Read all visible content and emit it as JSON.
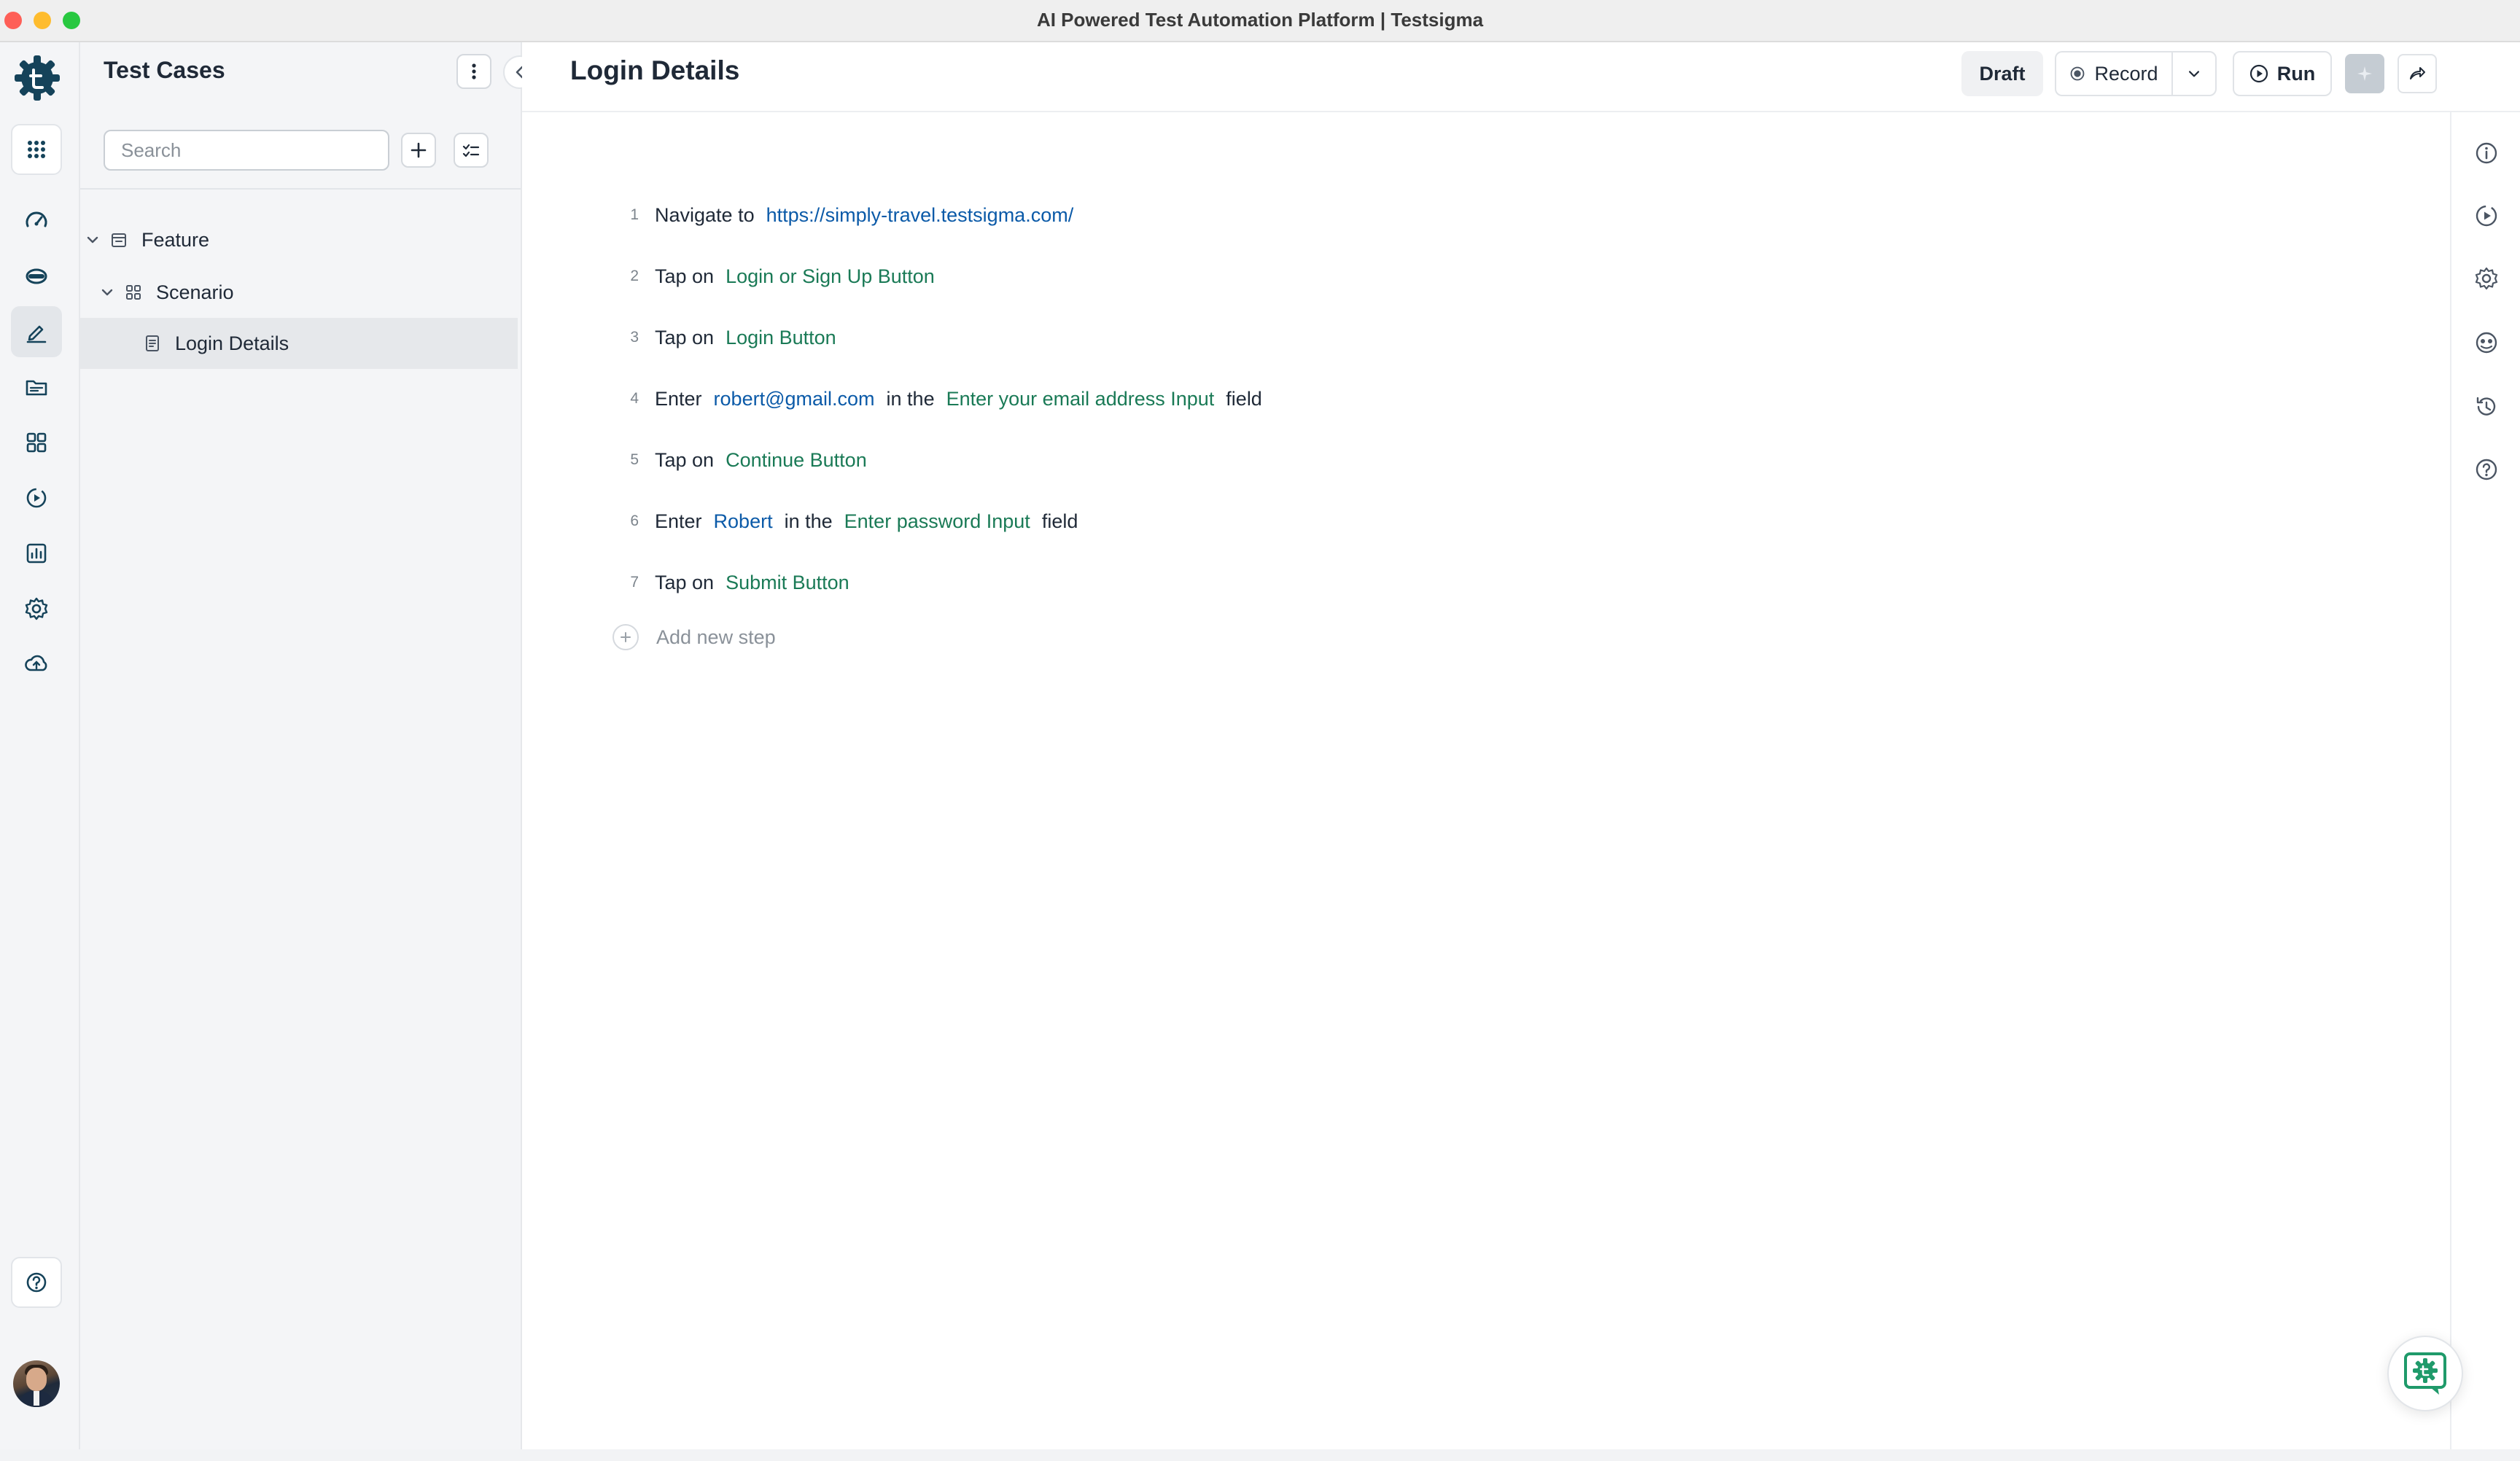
{
  "window": {
    "title": "AI Powered Test Automation Platform | Testsigma"
  },
  "sidebar": {
    "title": "Test Cases",
    "search_placeholder": "Search",
    "tree": [
      {
        "label": "Feature",
        "level": 0,
        "type": "folder"
      },
      {
        "label": "Scenario",
        "level": 1,
        "type": "group"
      },
      {
        "label": "Login Details",
        "level": 2,
        "type": "test-case",
        "selected": true
      }
    ]
  },
  "main": {
    "title": "Login Details",
    "toolbar": {
      "draft_label": "Draft",
      "record_label": "Record",
      "run_label": "Run"
    },
    "steps": [
      {
        "number": "1",
        "parts": [
          {
            "text": "Navigate to",
            "kind": "plain"
          },
          {
            "text": "https://simply-travel.testsigma.com/",
            "kind": "data"
          }
        ]
      },
      {
        "number": "2",
        "parts": [
          {
            "text": "Tap on",
            "kind": "plain"
          },
          {
            "text": "Login or Sign Up Button",
            "kind": "element"
          }
        ]
      },
      {
        "number": "3",
        "parts": [
          {
            "text": "Tap on",
            "kind": "plain"
          },
          {
            "text": "Login Button",
            "kind": "element"
          }
        ]
      },
      {
        "number": "4",
        "parts": [
          {
            "text": "Enter",
            "kind": "plain"
          },
          {
            "text": "robert@gmail.com",
            "kind": "data"
          },
          {
            "text": "in the",
            "kind": "plain"
          },
          {
            "text": "Enter your email address Input",
            "kind": "element"
          },
          {
            "text": "field",
            "kind": "plain"
          }
        ]
      },
      {
        "number": "5",
        "parts": [
          {
            "text": "Tap on",
            "kind": "plain"
          },
          {
            "text": "Continue Button",
            "kind": "element"
          }
        ]
      },
      {
        "number": "6",
        "parts": [
          {
            "text": "Enter",
            "kind": "plain"
          },
          {
            "text": "Robert",
            "kind": "data"
          },
          {
            "text": "in the",
            "kind": "plain"
          },
          {
            "text": "Enter password Input",
            "kind": "element"
          },
          {
            "text": "field",
            "kind": "plain"
          }
        ]
      },
      {
        "number": "7",
        "parts": [
          {
            "text": "Tap on",
            "kind": "plain"
          },
          {
            "text": "Submit Button",
            "kind": "element"
          }
        ]
      }
    ],
    "add_step_label": "Add new step"
  },
  "icons": {
    "rail": [
      "testsigma-logo-icon",
      "apps-grid-icon",
      "dashboard-gauge-icon",
      "test-data-icon",
      "test-case-edit-icon",
      "folder-icon",
      "modules-grid-icon",
      "run-results-icon",
      "reports-chart-icon",
      "settings-gear-icon",
      "cloud-upload-icon",
      "help-icon",
      "user-avatar"
    ],
    "right_rail": [
      "info-icon",
      "run-history-icon",
      "settings-gear-icon",
      "ai-agent-icon",
      "history-icon",
      "help-icon"
    ]
  },
  "colors": {
    "brand": "#15435a",
    "data_text": "#0b5aa8",
    "element_text": "#1a7a56",
    "chat_accent": "#1f9a6a"
  }
}
